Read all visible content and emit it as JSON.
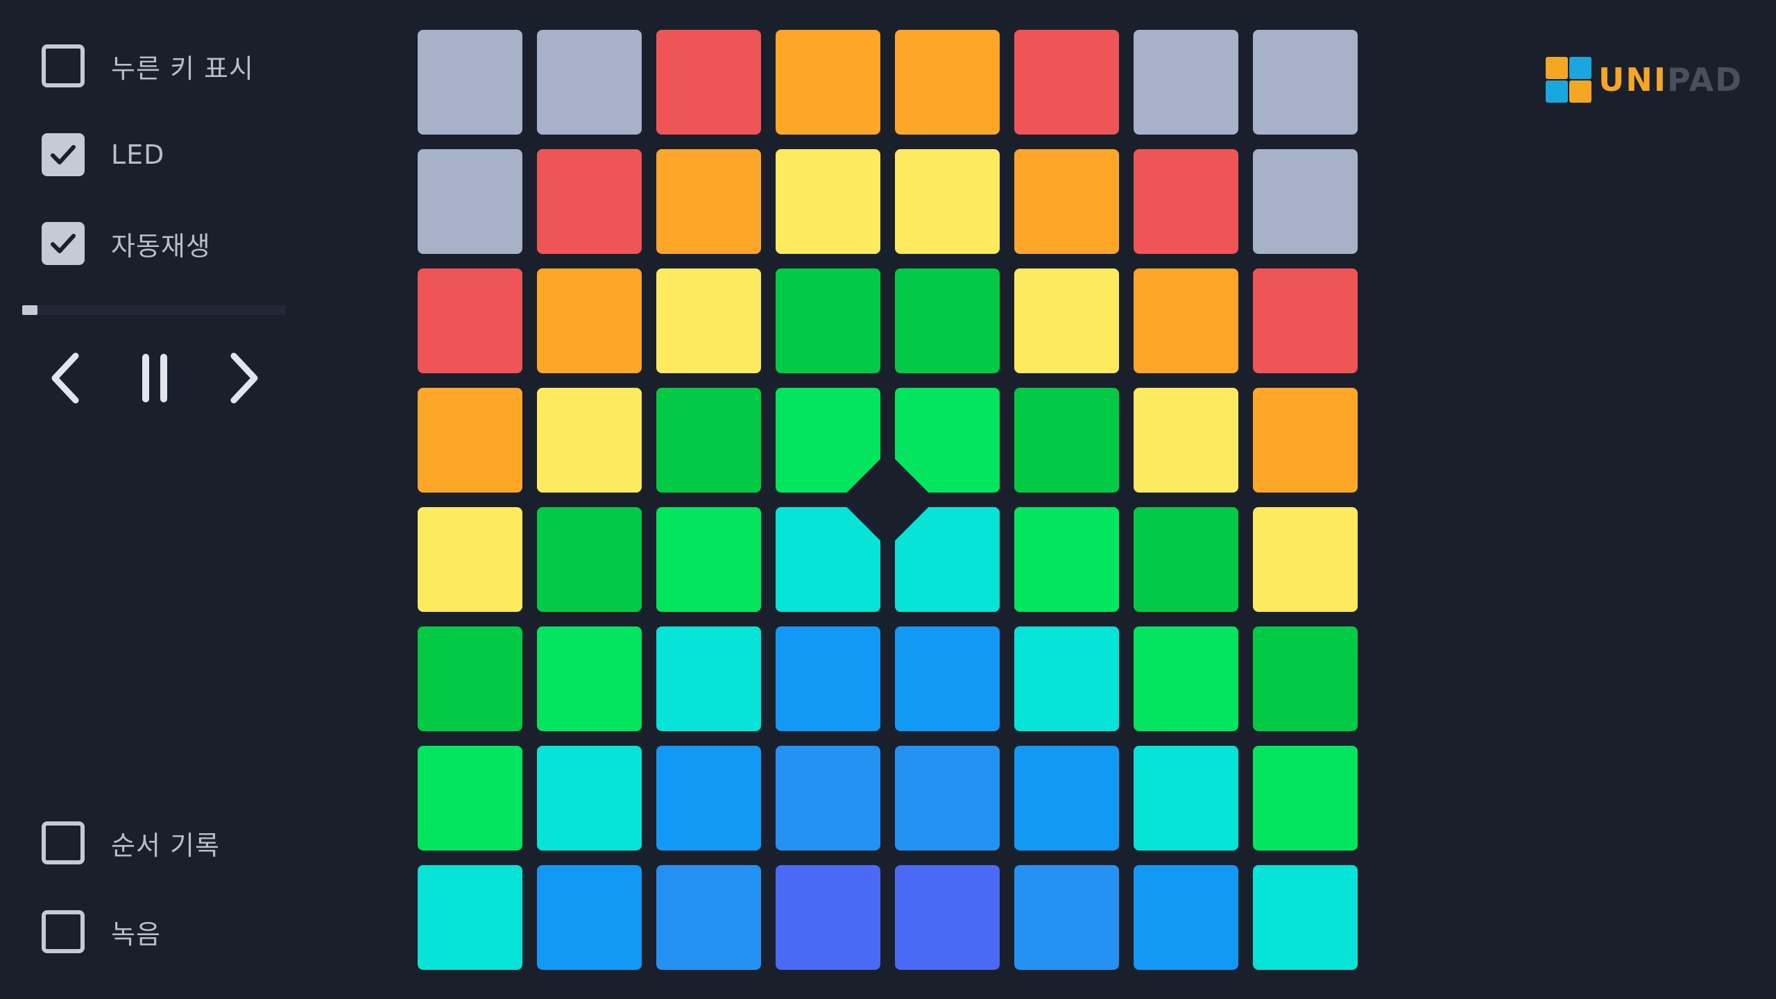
{
  "options_top": [
    {
      "label": "누른 키 표시",
      "checked": false
    },
    {
      "label": "LED",
      "checked": true
    },
    {
      "label": "자동재생",
      "checked": true
    }
  ],
  "options_bottom": [
    {
      "label": "순서 기록",
      "checked": false
    },
    {
      "label": "녹음",
      "checked": false
    }
  ],
  "autoplay_progress": 0.05,
  "nav": {
    "prev_icon": "chevron-left-icon",
    "pause_icon": "pause-icon",
    "next_icon": "chevron-right-icon"
  },
  "logo": {
    "text_highlight": "UNI",
    "text_rest": "PAD",
    "highlight_color": "#f5a623",
    "rest_color": "#4a4f5c",
    "icon_colors": [
      "#f5a623",
      "#1aa7e0",
      "#1aa7e0",
      "#f5a623"
    ]
  },
  "palette": {
    "G": "#a7b2c9",
    "R": "#ef5556",
    "O": "#fea628",
    "Y": "#feea5f",
    "D": "#03ca44",
    "L": "#03e55e",
    "C": "#06e4d8",
    "B": "#1299f6",
    "M": "#2492f3",
    "I": "#4a6af5"
  },
  "grid": [
    [
      "G",
      "G",
      "R",
      "O",
      "O",
      "R",
      "G",
      "G"
    ],
    [
      "G",
      "R",
      "O",
      "Y",
      "Y",
      "O",
      "R",
      "G"
    ],
    [
      "R",
      "O",
      "Y",
      "D",
      "D",
      "Y",
      "O",
      "R"
    ],
    [
      "O",
      "Y",
      "D",
      "L",
      "L",
      "D",
      "Y",
      "O"
    ],
    [
      "Y",
      "D",
      "L",
      "C",
      "C",
      "L",
      "D",
      "Y"
    ],
    [
      "D",
      "L",
      "C",
      "B",
      "B",
      "C",
      "L",
      "D"
    ],
    [
      "L",
      "C",
      "B",
      "M",
      "M",
      "B",
      "C",
      "L"
    ],
    [
      "C",
      "B",
      "M",
      "I",
      "I",
      "M",
      "B",
      "C"
    ]
  ],
  "colors": {
    "background": "#1a1f2c",
    "control": "#c6cad6",
    "label": "#b9bdc9",
    "check": "#1a1f2c"
  }
}
